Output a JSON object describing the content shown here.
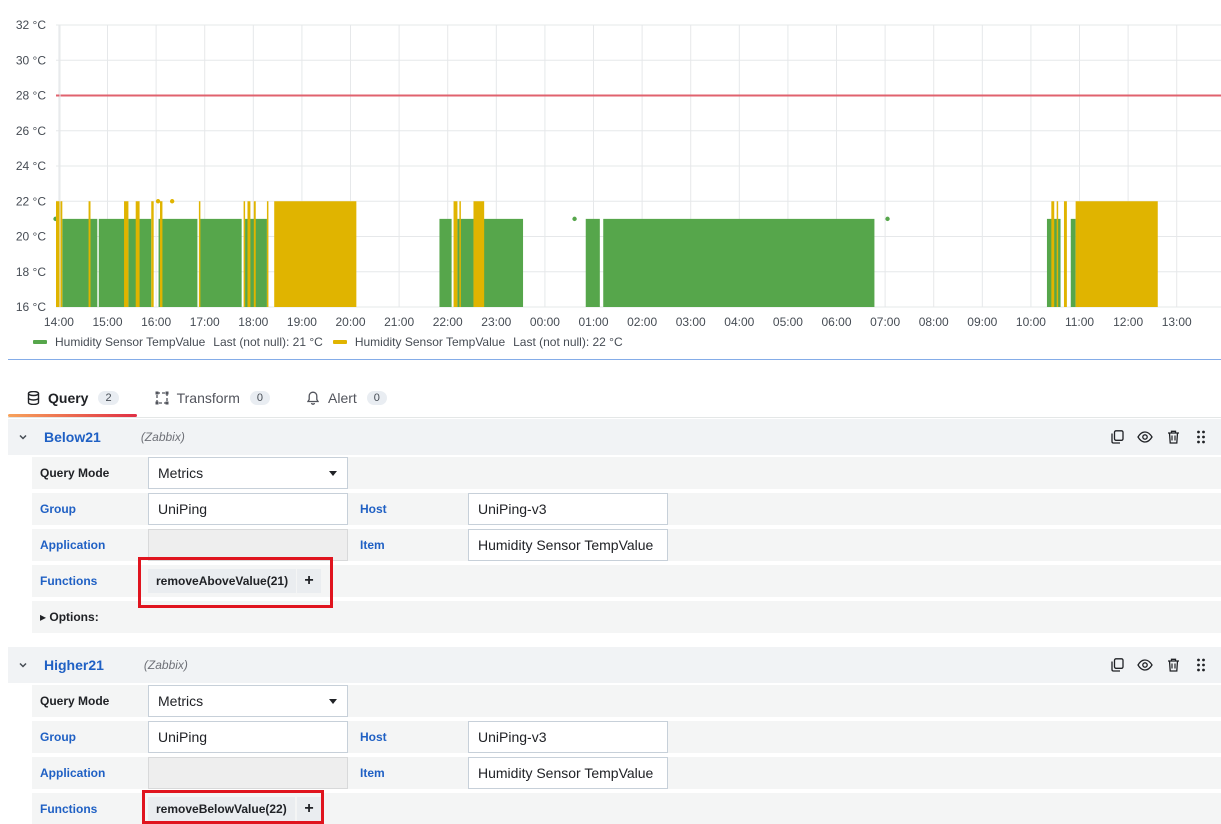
{
  "chart_data": {
    "type": "area",
    "y_ticks": [
      "16 °C",
      "18 °C",
      "20 °C",
      "22 °C",
      "24 °C",
      "26 °C",
      "28 °C",
      "30 °C",
      "32 °C"
    ],
    "ylim": [
      16,
      32
    ],
    "x_ticks": [
      "14:00",
      "15:00",
      "16:00",
      "17:00",
      "18:00",
      "19:00",
      "20:00",
      "21:00",
      "22:00",
      "23:00",
      "00:00",
      "01:00",
      "02:00",
      "03:00",
      "04:00",
      "05:00",
      "06:00",
      "07:00",
      "08:00",
      "09:00",
      "10:00",
      "11:00",
      "12:00",
      "13:00"
    ],
    "xlim": [
      13.94,
      24.77
    ],
    "threshold": {
      "value": 28,
      "color": "#e0626e"
    },
    "grid": true,
    "series": [
      {
        "name": "Humidity Sensor TempValue",
        "color": "#56a64b",
        "value": 21,
        "segments": [
          [
            14.07,
            14.79
          ],
          [
            14.82,
            15.38
          ],
          [
            15.43,
            15.9
          ],
          [
            16.05,
            16.85
          ],
          [
            16.9,
            17.76
          ],
          [
            17.83,
            18.28
          ],
          [
            21.83,
            22.08
          ],
          [
            22.2,
            22.53
          ],
          [
            22.7,
            23.55
          ],
          [
            24.84,
            25.13
          ],
          [
            25.2,
            30.78
          ],
          [
            34.33,
            34.61
          ],
          [
            34.82,
            34.92
          ]
        ],
        "points": [
          [
            13.93,
            21
          ],
          [
            24.61,
            21
          ],
          [
            31.05,
            21
          ]
        ]
      },
      {
        "name": "Humidity Sensor TempValue",
        "color": "#e0b400",
        "value": 22,
        "segments": [
          [
            13.94,
            14.07
          ],
          [
            14.61,
            14.65
          ],
          [
            15.34,
            15.43
          ],
          [
            15.58,
            15.66
          ],
          [
            15.9,
            15.95
          ],
          [
            16.08,
            16.13
          ],
          [
            16.88,
            16.91
          ],
          [
            17.8,
            17.82
          ],
          [
            17.88,
            17.94
          ],
          [
            18.01,
            18.05
          ],
          [
            18.28,
            18.3
          ],
          [
            18.43,
            20.12
          ],
          [
            22.12,
            22.2
          ],
          [
            22.24,
            22.27
          ],
          [
            22.53,
            22.75
          ],
          [
            34.42,
            34.48
          ],
          [
            34.53,
            34.55
          ],
          [
            34.68,
            34.74
          ],
          [
            34.92,
            35.0
          ],
          [
            35.0,
            36.61
          ]
        ],
        "points": [
          [
            16.04,
            22
          ],
          [
            16.33,
            22
          ]
        ]
      }
    ]
  },
  "legend": [
    {
      "name": "Humidity Sensor TempValue",
      "stat": "Last (not null): 21 °C",
      "color": "#56a64b"
    },
    {
      "name": "Humidity Sensor TempValue",
      "stat": "Last (not null): 22 °C",
      "color": "#e0b400"
    }
  ],
  "tabs": [
    {
      "label": "Query",
      "count": "2",
      "icon": "database-icon",
      "active": true
    },
    {
      "label": "Transform",
      "count": "0",
      "icon": "transform-icon",
      "active": false
    },
    {
      "label": "Alert",
      "count": "0",
      "icon": "bell-icon",
      "active": false
    }
  ],
  "queries": [
    {
      "name": "Below21",
      "datasource": "(Zabbix)",
      "query_mode_label": "Query Mode",
      "query_mode": "Metrics",
      "group_label": "Group",
      "group": "UniPing",
      "host_label": "Host",
      "host": "UniPing-v3",
      "application_label": "Application",
      "application": "",
      "item_label": "Item",
      "item": "Humidity Sensor TempValue",
      "functions_label": "Functions",
      "function": "removeAboveValue(21)",
      "add_symbol": "+",
      "options_label": "Options:"
    },
    {
      "name": "Higher21",
      "datasource": "(Zabbix)",
      "query_mode_label": "Query Mode",
      "query_mode": "Metrics",
      "group_label": "Group",
      "group": "UniPing",
      "host_label": "Host",
      "host": "UniPing-v3",
      "application_label": "Application",
      "application": "",
      "item_label": "Item",
      "item": "Humidity Sensor TempValue",
      "functions_label": "Functions",
      "function": "removeBelowValue(22)",
      "add_symbol": "+"
    }
  ],
  "colors": {
    "accent": "#1f60c4",
    "highlight": "#e0141e"
  }
}
